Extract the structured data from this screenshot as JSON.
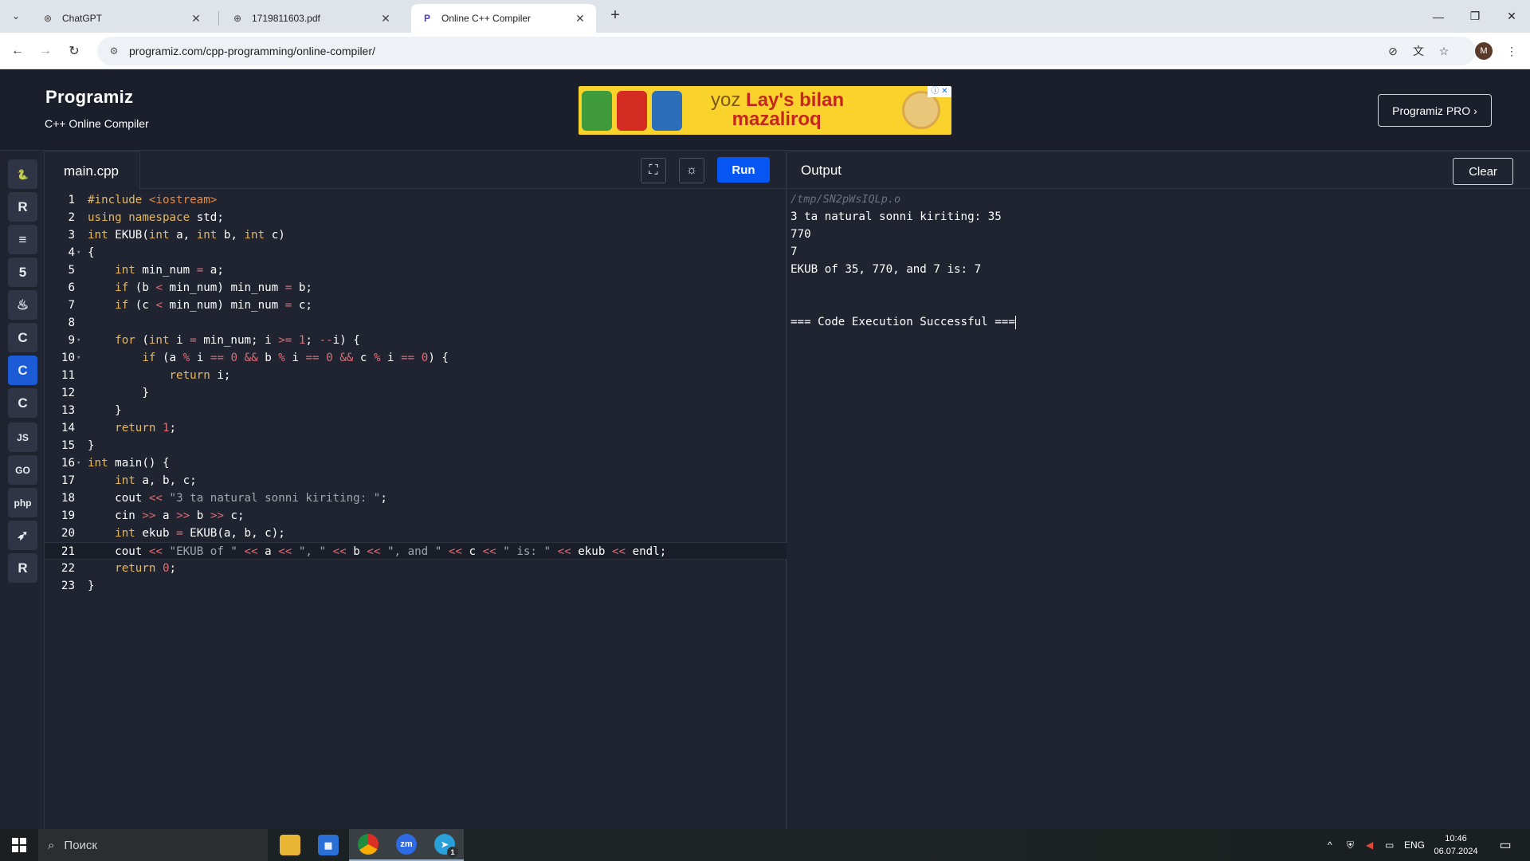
{
  "browser": {
    "tabs": [
      {
        "label": "ChatGPT",
        "icon": "chatgpt-icon",
        "active": false
      },
      {
        "label": "1719811603.pdf",
        "icon": "globe-icon",
        "active": false
      },
      {
        "label": "Online C++ Compiler",
        "icon": "programiz-icon",
        "active": true
      }
    ],
    "url": "programiz.com/cpp-programming/online-compiler/"
  },
  "header": {
    "logo": "Programiz",
    "subtitle": "C++ Online Compiler",
    "ad_text_line1": "yoz",
    "ad_brand": "Lay's",
    "ad_text_line1_end": "bilan",
    "ad_text_line2": "mazaliroq",
    "pro_button": "Programiz PRO"
  },
  "sidebar": {
    "languages": [
      {
        "name": "python-icon",
        "glyph": "🐍"
      },
      {
        "name": "r-icon",
        "glyph": "R"
      },
      {
        "name": "sql-icon",
        "glyph": "≡"
      },
      {
        "name": "html-icon",
        "glyph": "5"
      },
      {
        "name": "java-icon",
        "glyph": "♨"
      },
      {
        "name": "c-icon",
        "glyph": "C"
      },
      {
        "name": "cpp-icon",
        "glyph": "C",
        "active": true
      },
      {
        "name": "csharp-icon",
        "glyph": "C"
      },
      {
        "name": "javascript-icon",
        "glyph": "JS"
      },
      {
        "name": "go-icon",
        "glyph": "GO"
      },
      {
        "name": "php-icon",
        "glyph": "php"
      },
      {
        "name": "swift-icon",
        "glyph": "➶"
      },
      {
        "name": "rust-icon",
        "glyph": "R"
      }
    ]
  },
  "editor": {
    "file_name": "main.cpp",
    "run_label": "Run",
    "current_line": 21,
    "lines": [
      "#include <iostream>",
      "using namespace std;",
      "int EKUB(int a, int b, int c)",
      "{",
      "    int min_num = a;",
      "    if (b < min_num) min_num = b;",
      "    if (c < min_num) min_num = c;",
      "",
      "    for (int i = min_num; i >= 1; --i) {",
      "        if (a % i == 0 && b % i == 0 && c % i == 0) {",
      "            return i;",
      "        }",
      "    }",
      "    return 1;",
      "}",
      "int main() {",
      "    int a, b, c;",
      "    cout << \"3 ta natural sonni kiriting: \";",
      "    cin >> a >> b >> c;",
      "    int ekub = EKUB(a, b, c);",
      "    cout << \"EKUB of \" << a << \", \" << b << \", and \" << c << \" is: \" << ekub << endl;",
      "    return 0;",
      "}"
    ],
    "foldable_lines": [
      4,
      9,
      10,
      16
    ]
  },
  "output": {
    "title": "Output",
    "clear_label": "Clear",
    "path_line": "/tmp/SN2pWsIQLp.o",
    "lines": [
      "3 ta natural sonni kiriting: 35",
      "770",
      "7",
      "EKUB of 35, 770, and 7 is: 7",
      "",
      "",
      "=== Code Execution Successful ==="
    ]
  },
  "taskbar": {
    "search_placeholder": "Поиск",
    "language": "ENG",
    "time": "10:46",
    "date": "06.07.2024",
    "telegram_badge": "1"
  }
}
